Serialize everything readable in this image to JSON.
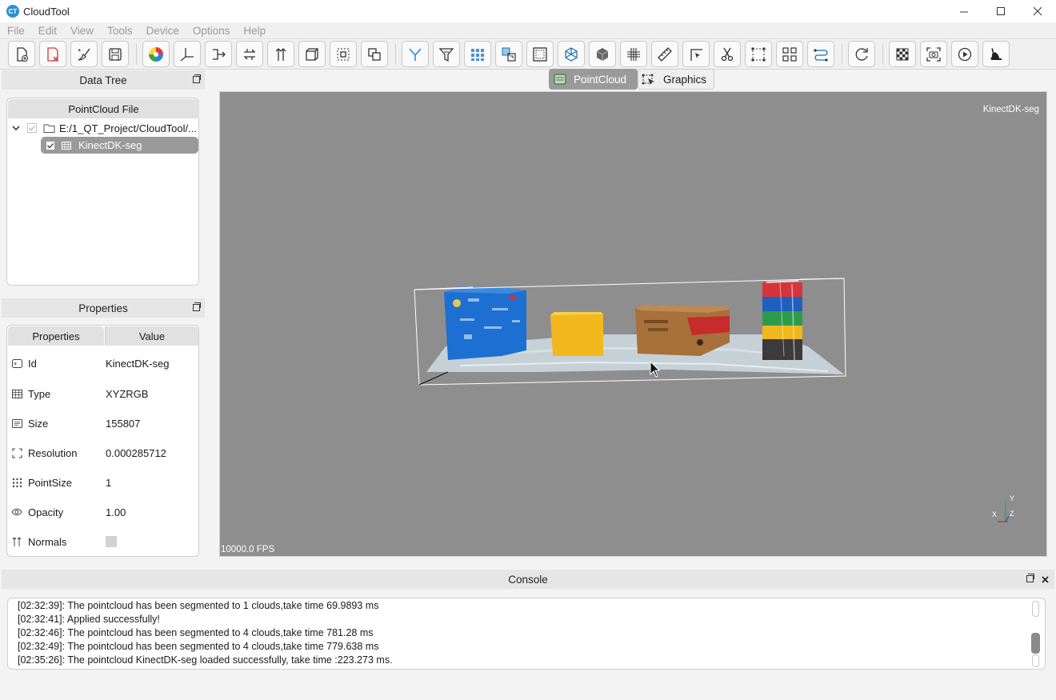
{
  "app": {
    "title": "CloudTool",
    "logo_text": "CT"
  },
  "menu": [
    "File",
    "Edit",
    "View",
    "Tools",
    "Device",
    "Options",
    "Help"
  ],
  "toolbar_icons": [
    "new-file-icon",
    "delete-icon",
    "clean-icon",
    "save-icon",
    "color-wheel-icon",
    "axis-icon",
    "merge-icon",
    "transform-icon",
    "normals-icon",
    "bounding-box-icon",
    "crop-icon",
    "duplicate-icon",
    "filter-y-icon",
    "funnel-icon",
    "grid-icon",
    "convert-icon",
    "voxel-icon",
    "mesh-icon",
    "cube-icon",
    "hash-grid-icon",
    "ruler-icon",
    "pick-icon",
    "cut-icon",
    "select-rect-icon",
    "segment-icon",
    "path-icon",
    "refresh-icon",
    "checkerboard-icon",
    "screenshot-icon",
    "play-icon",
    "rabbit-icon"
  ],
  "data_tree": {
    "title": "Data Tree",
    "header": "PointCloud File",
    "folder_label": "E:/1_QT_Project/CloudTool/...",
    "item_label": "KinectDK-seg"
  },
  "properties": {
    "title": "Properties",
    "col_name": "Properties",
    "col_value": "Value",
    "rows": [
      {
        "name": "Id",
        "value": "KinectDK-seg",
        "icon": "tag-icon"
      },
      {
        "name": "Type",
        "value": "XYZRGB",
        "icon": "table-icon"
      },
      {
        "name": "Size",
        "value": "155807",
        "icon": "list-icon"
      },
      {
        "name": "Resolution",
        "value": "0.000285712",
        "icon": "resolution-icon"
      },
      {
        "name": "PointSize",
        "value": "1",
        "icon": "dots-icon"
      },
      {
        "name": "Opacity",
        "value": "1.00",
        "icon": "eye-icon"
      },
      {
        "name": "Normals",
        "value": "",
        "icon": "normals-icon"
      }
    ]
  },
  "view_tabs": {
    "pointcloud": "PointCloud",
    "graphics": "Graphics"
  },
  "viewport": {
    "cloud_label": "KinectDK-seg",
    "fps": "10000.0 FPS",
    "axis_x": "X",
    "axis_y": "Y",
    "axis_z": "Z"
  },
  "console": {
    "title": "Console",
    "lines": [
      "[02:32:39]: The pointcloud has been segmented to 1 clouds,take time 69.9893 ms",
      "[02:32:41]: Applied successfully!",
      "[02:32:46]: The pointcloud has been segmented to 4 clouds,take time 781.28 ms",
      "[02:32:49]: The pointcloud has been segmented to 4 clouds,take time 779.638 ms",
      "[02:35:26]: The pointcloud KinectDK-seg loaded successfully, take time :223.273 ms."
    ]
  }
}
